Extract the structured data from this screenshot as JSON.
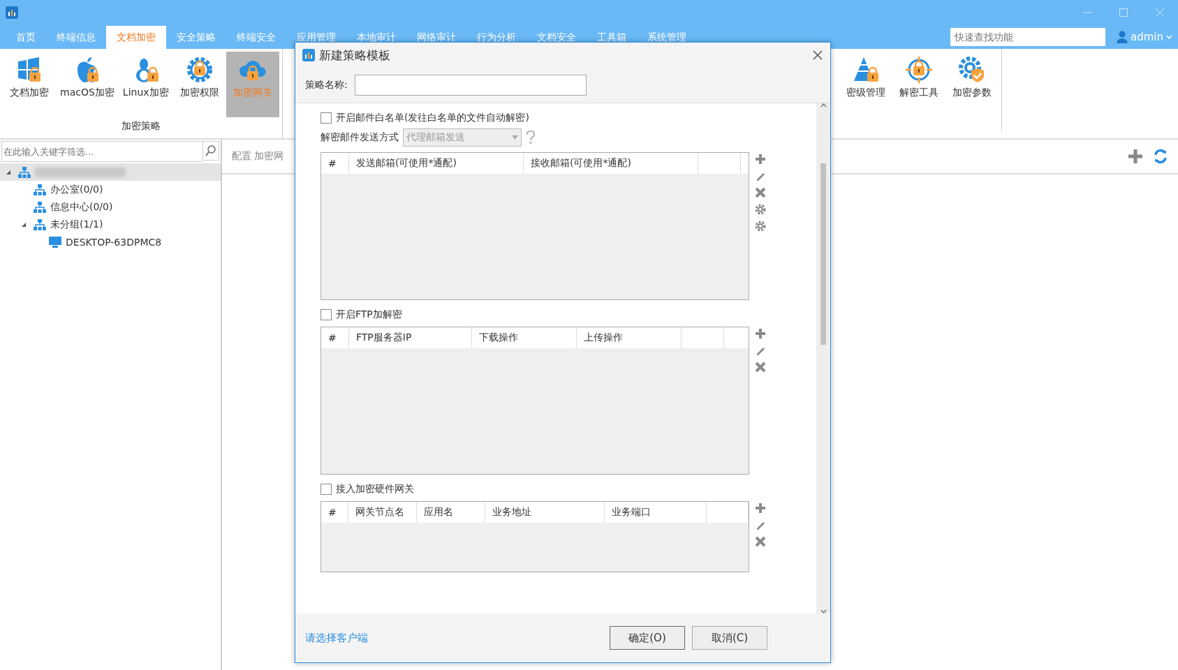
{
  "menu": [
    {
      "label": "首页",
      "selected": false
    },
    {
      "label": "终端信息",
      "selected": false
    },
    {
      "label": "文档加密",
      "selected": true
    },
    {
      "label": "安全策略",
      "selected": false
    },
    {
      "label": "终端安全",
      "selected": false
    },
    {
      "label": "应用管理",
      "selected": false
    },
    {
      "label": "本地审计",
      "selected": false
    },
    {
      "label": "网络审计",
      "selected": false
    },
    {
      "label": "行为分析",
      "selected": false
    },
    {
      "label": "文档安全",
      "selected": false
    },
    {
      "label": "工具箱",
      "selected": false
    },
    {
      "label": "系统管理",
      "selected": false
    }
  ],
  "search": {
    "placeholder": "快速查找功能"
  },
  "user": "admin",
  "ribbon": {
    "group_label": "加密策略",
    "left": [
      {
        "label": "文档加密",
        "kind": "windows",
        "selected": false
      },
      {
        "label": "macOS加密",
        "kind": "apple",
        "selected": false
      },
      {
        "label": "Linux加密",
        "kind": "linux",
        "selected": false
      },
      {
        "label": "加密权限",
        "kind": "gear",
        "selected": false
      },
      {
        "label": "加密网关",
        "kind": "cloud",
        "selected": true
      }
    ],
    "right": [
      {
        "label": "密级管理",
        "kind": "pyramid",
        "selected": false
      },
      {
        "label": "解密工具",
        "kind": "target",
        "selected": false
      },
      {
        "label": "加密参数",
        "kind": "gearcheck",
        "selected": false
      }
    ]
  },
  "filter": {
    "placeholder": "在此输入关键字筛选..."
  },
  "tree": [
    {
      "selected": true,
      "expanded": true,
      "kind": "group",
      "children": [
        {
          "label": "办公室(0/0)",
          "selected": false,
          "kind": "group"
        },
        {
          "label": "信息中心(0/0)",
          "selected": false,
          "kind": "group"
        },
        {
          "label": "未分组(1/1)",
          "selected": false,
          "expanded": true,
          "kind": "group",
          "children": [
            {
              "label": "DESKTOP-63DPMC8",
              "selected": false,
              "kind": "computer"
            }
          ]
        }
      ]
    }
  ],
  "content_title": "配置 加密网",
  "dialog": {
    "title": "新建策略模板",
    "name_label": "策略名称:",
    "sections": [
      {
        "checkbox": "开启邮件白名单(发往白名单的文件自动解密)",
        "checked": false,
        "send_mode_label": "解密邮件发送方式",
        "send_mode_value": "代理邮箱发送",
        "columns": [
          "#",
          "发送邮箱(可使用*通配)",
          "接收邮箱(可使用*通配)"
        ],
        "actions": [
          {
            "kind": "add"
          },
          {
            "kind": "edit"
          },
          {
            "kind": "delete"
          },
          {
            "kind": "settings"
          },
          {
            "kind": "settings"
          }
        ]
      },
      {
        "checkbox": "开启FTP加解密",
        "checked": false,
        "columns": [
          "#",
          "FTP服务器IP",
          "下载操作",
          "上传操作"
        ],
        "actions": [
          {
            "kind": "add"
          },
          {
            "kind": "edit"
          },
          {
            "kind": "delete"
          }
        ]
      },
      {
        "checkbox": "接入加密硬件网关",
        "checked": false,
        "columns": [
          "#",
          "网关节点名",
          "应用名",
          "业务地址",
          "业务端口"
        ],
        "actions": [
          {
            "kind": "add"
          },
          {
            "kind": "edit"
          },
          {
            "kind": "delete"
          }
        ]
      }
    ],
    "client_link": "请选择客户端",
    "ok": "确定(O)",
    "cancel": "取消(C)"
  }
}
